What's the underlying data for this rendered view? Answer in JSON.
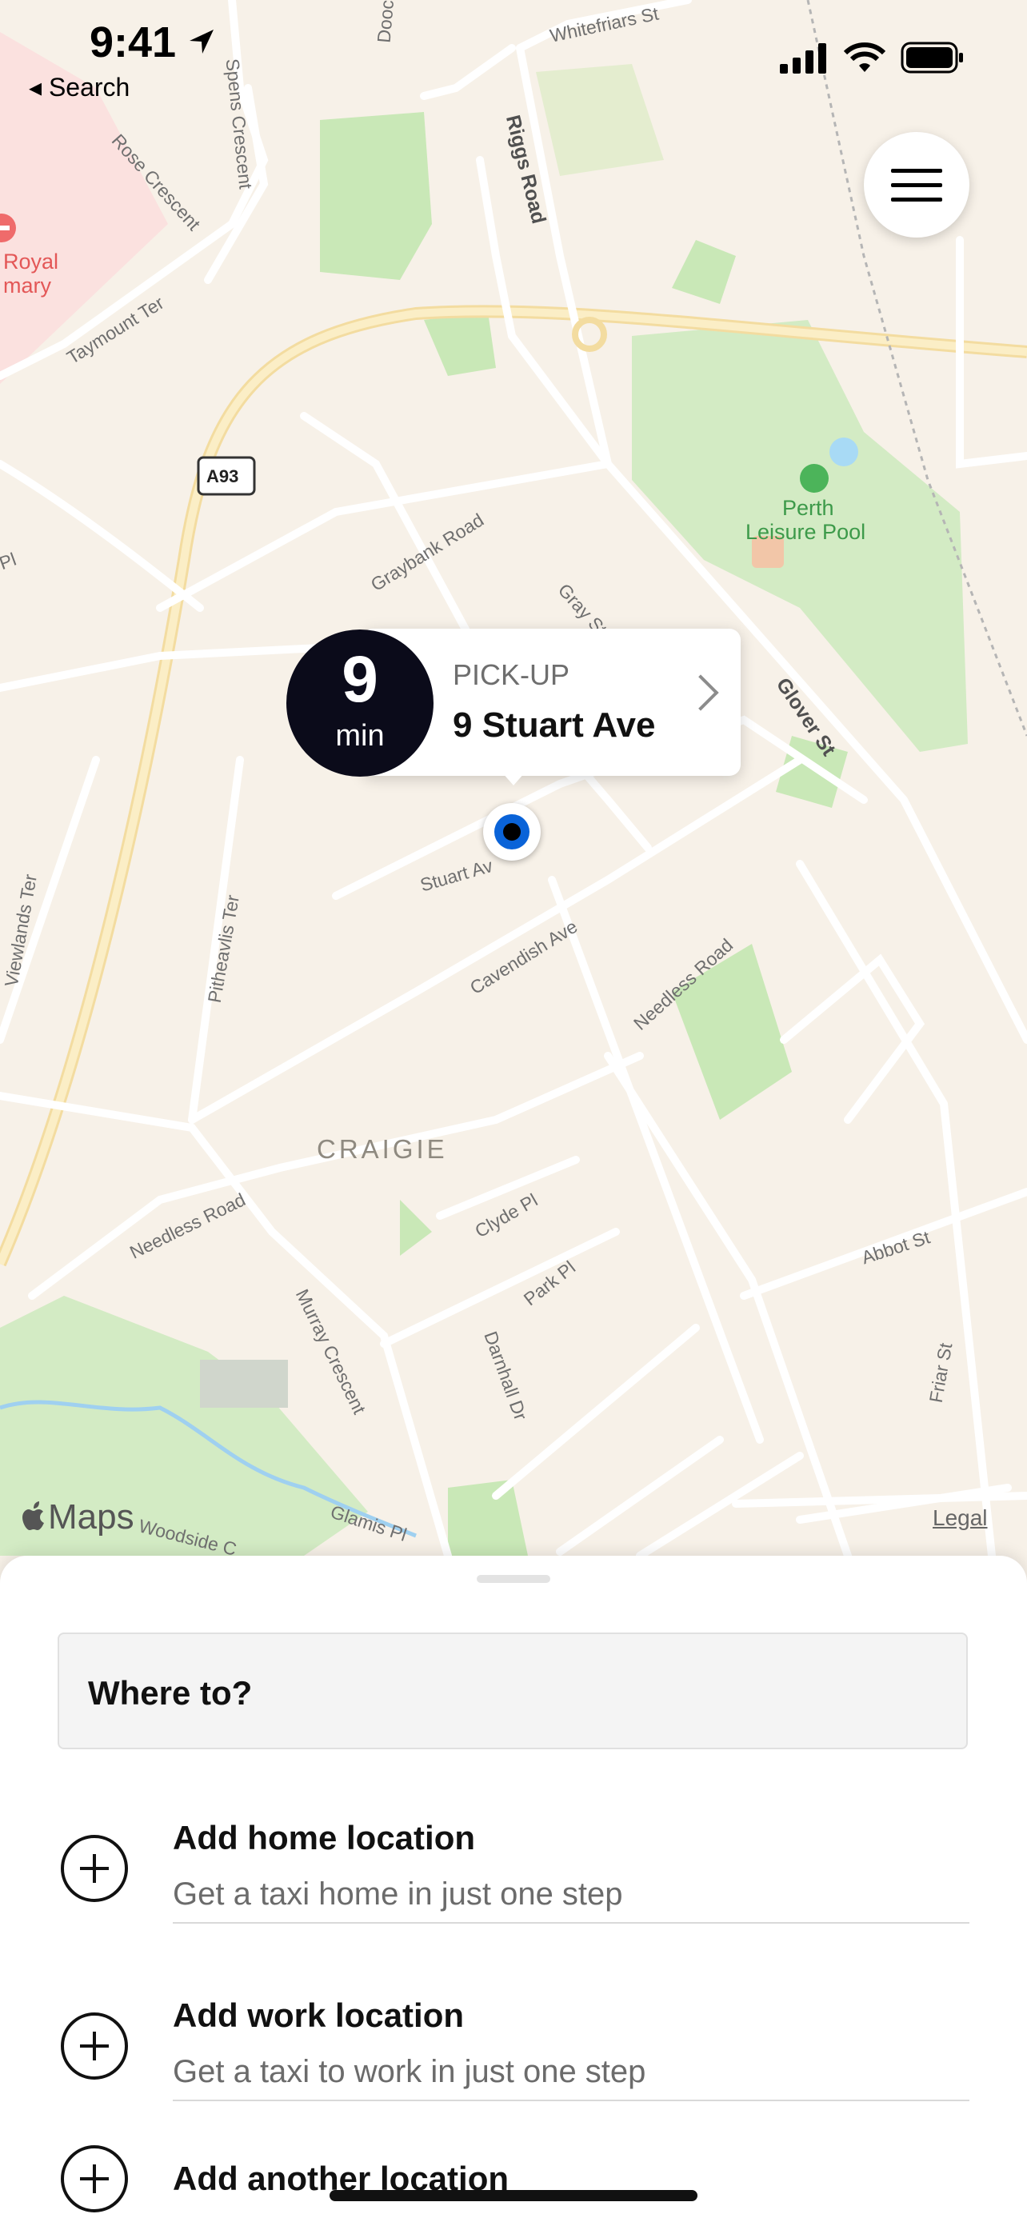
{
  "status_bar": {
    "time": "9:41",
    "back_label": "◂ Search"
  },
  "map": {
    "labels": {
      "whitefriars": "Whitefriars St",
      "riggs": "Riggs Road",
      "doocot": "Doocot C",
      "spens": "Spens Crescent",
      "rose": "Rose Crescent",
      "royal": "Royal",
      "mary": "mary",
      "taymount": "Taymount Ter",
      "a93": "A93",
      "graybank": "Graybank Road",
      "gray": "Gray St",
      "perth_pool_1": "Perth",
      "perth_pool_2": "Leisure Pool",
      "glover": "Glover St",
      "pl": "Pl",
      "viewlands": "Viewlands Ter",
      "pitheavlis": "Pitheavlis Ter",
      "stuart": "Stuart Av",
      "cavendish": "Cavendish Ave",
      "needless_ne": "Needless Road",
      "craigie": "CRAIGIE",
      "needless_w": "Needless Road",
      "clyde": "Clyde Pl",
      "park": "Park Pl",
      "murray": "Murray Crescent",
      "darnhall": "Darnhall Dr",
      "abbot": "Abbot St",
      "friar": "Friar St",
      "woodside": "Woodside C",
      "glamis": "Glamis Pl"
    },
    "maps_logo": "Maps",
    "legal": "Legal"
  },
  "pickup": {
    "eta_value": "9",
    "eta_unit": "min",
    "label": "PICK-UP",
    "address": "9 Stuart Ave"
  },
  "sheet": {
    "search_placeholder": "Where to?",
    "locations": [
      {
        "title": "Add home location",
        "subtitle": "Get a taxi home in just one step"
      },
      {
        "title": "Add work location",
        "subtitle": "Get a taxi to work in just one step"
      },
      {
        "title": "Add another location",
        "subtitle": ""
      }
    ]
  }
}
